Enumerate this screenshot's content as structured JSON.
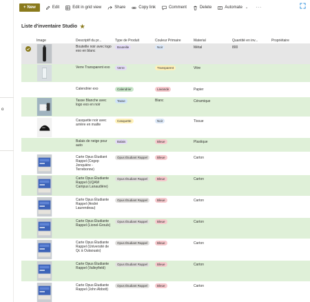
{
  "toolbar": {
    "new_label": "New",
    "edit_label": "Edit",
    "grid_label": "Edit in grid view",
    "share_label": "Share",
    "copy_label": "Copy link",
    "comment_label": "Comment",
    "delete_label": "Delete",
    "automate_label": "Automate",
    "more_label": "···"
  },
  "list": {
    "title": "Liste d'inventaire Studio"
  },
  "columns": {
    "image": "Image",
    "desc": "Descriptif du pr...",
    "type": "Type de Produit",
    "color": "Couleur Primaire",
    "material": "Material",
    "qty": "Quantité en inv...",
    "owner": "Propriétaire"
  },
  "rows": [
    {
      "desc": "Bouteille noir avec logo exo en blanc",
      "type": "Bouteille",
      "color": "Noir",
      "material": "Métal",
      "qty": "800",
      "thumb": "bottle"
    },
    {
      "desc": "Verre Transparent exo",
      "type": "Verre",
      "color": "Transparent",
      "material": "Vitre",
      "qty": "",
      "thumb": "glass"
    },
    {
      "desc": "Calendrier exo",
      "type": "Calendrier",
      "color": "Lavande",
      "material": "Papier",
      "qty": "",
      "thumb": ""
    },
    {
      "desc": "Tasse Blanche avec logo exo en noir",
      "type": "Tasse",
      "color": "Blanc",
      "material": "Céramique",
      "qty": "",
      "thumb": "mug"
    },
    {
      "desc": "Casquette noir avec arrière en mailte",
      "type": "Casquette",
      "color": "Noir",
      "material": "Tissue",
      "qty": "",
      "thumb": "cap"
    },
    {
      "desc": "Balais de neige pour auto",
      "type": "Balais",
      "color": "Bleue",
      "material": "Plastique",
      "qty": "",
      "thumb": ""
    },
    {
      "desc": "Carte Opus Étudiant Rappel (Cegep Jonquière - Terrebonne)",
      "type": "Opus Étudiant Rappel",
      "color": "Bleue",
      "material": "Carton",
      "qty": "",
      "thumb": "card"
    },
    {
      "desc": "Carte Opus Étudiante Rappel (UQAM Campus Lanaudière)",
      "type": "Opus Étudiant Rappel",
      "color": "Bleue",
      "material": "Carton",
      "qty": "",
      "thumb": "card"
    },
    {
      "desc": "Carte Opus Étudiante Rappel (André Laurendeau)",
      "type": "Opus Étudiant Rappel",
      "color": "Bleue",
      "material": "Carton",
      "qty": "",
      "thumb": "card"
    },
    {
      "desc": "Carte Opus Étudiante Rappel (Lionel-Groulx)",
      "type": "Opus Étudiant Rappel",
      "color": "Bleue",
      "material": "Carton",
      "qty": "",
      "thumb": "card"
    },
    {
      "desc": "Carte Opus Étudiante Rappel (Université de Qc à Outaouais)",
      "type": "Opus Étudiant Rappel",
      "color": "Bleue",
      "material": "Carton",
      "qty": "",
      "thumb": "card"
    },
    {
      "desc": "Carte Opus Étudiante Rappel (Valleyfield)",
      "type": "Opus Étudiant Rappel",
      "color": "Bleue",
      "material": "Carton",
      "qty": "",
      "thumb": "card"
    },
    {
      "desc": "Carte Opus Étudiante Rappel (John Abbott)",
      "type": "Opus Étudiant Rappel",
      "color": "Bleue",
      "material": "Carton",
      "qty": "",
      "thumb": "card"
    }
  ],
  "colors": {
    "accent": "#8a7a1c",
    "alt_row": "#dff0d8",
    "selected_row": "#e6e6e6"
  }
}
